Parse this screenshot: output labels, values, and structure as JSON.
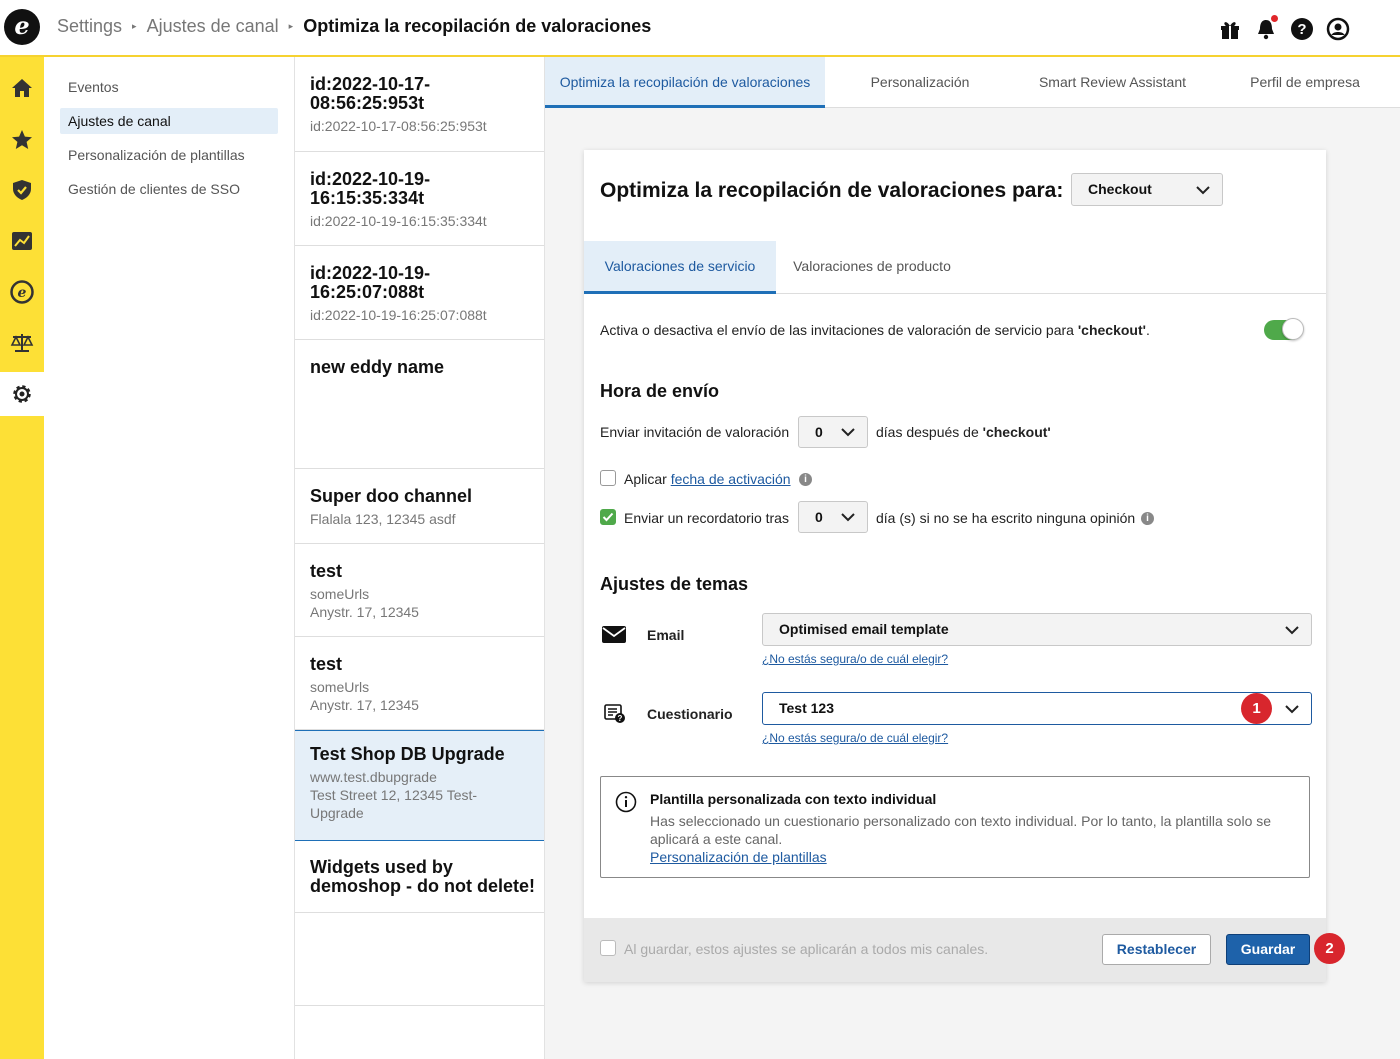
{
  "app": {
    "logo_glyph": "e",
    "accent": "#fde036",
    "brand_blue": "#1e6fb7"
  },
  "breadcrumb": {
    "items": [
      "Settings",
      "Ajustes de canal"
    ],
    "current": "Optimiza la recopilación de valoraciones"
  },
  "top_icons": [
    "gift-icon",
    "bell-icon",
    "help-icon",
    "user-icon"
  ],
  "rail": {
    "items": [
      "home-icon",
      "star-icon",
      "shield-icon",
      "chart-icon",
      "e-logo-icon",
      "scales-icon",
      "gear-icon"
    ],
    "active": "gear-icon"
  },
  "subnav": {
    "items": [
      {
        "label": "Eventos"
      },
      {
        "label": "Ajustes de canal",
        "active": true
      },
      {
        "label": "Personalización de plantillas"
      },
      {
        "label": "Gestión de clientes de SSO"
      }
    ]
  },
  "channels": [
    {
      "title": "id:2022-10-17-08:56:25:953t",
      "sub": [
        "id:2022-10-17-08:56:25:953t"
      ]
    },
    {
      "title": "id:2022-10-19-16:15:35:334t",
      "sub": [
        "id:2022-10-19-16:15:35:334t"
      ]
    },
    {
      "title": "id:2022-10-19-16:25:07:088t",
      "sub": [
        "id:2022-10-19-16:25:07:088t"
      ]
    },
    {
      "title": "new eddy name",
      "sub": []
    },
    {
      "title": "Super doo channel",
      "sub": [
        "Flalala 123, 12345 asdf"
      ]
    },
    {
      "title": "test",
      "sub": [
        "someUrls",
        "Anystr. 17, 12345"
      ]
    },
    {
      "title": "test",
      "sub": [
        "someUrls",
        "Anystr. 17, 12345"
      ]
    },
    {
      "title": "Test Shop DB Upgrade",
      "sub": [
        "www.test.dbupgrade",
        "Test Street 12, 12345 Test-Upgrade"
      ],
      "selected": true
    },
    {
      "title": "Widgets used by demoshop - do not delete!",
      "sub": []
    }
  ],
  "main_tabs": [
    {
      "label": "Optimiza la recopilación de valoraciones",
      "active": true
    },
    {
      "label": "Personalización"
    },
    {
      "label": "Smart Review Assistant"
    },
    {
      "label": "Perfil de empresa"
    }
  ],
  "card": {
    "title": "Optimiza la recopilación de valoraciones para:",
    "channel_select": "Checkout",
    "review_tabs": [
      {
        "label": "Valoraciones de servicio",
        "active": true
      },
      {
        "label": "Valoraciones de producto"
      }
    ],
    "toggle_text_pre": "Activa o desactiva el envío de las invitaciones de valoración de servicio para ",
    "toggle_text_bold": "'checkout'",
    "toggle_text_post": ".",
    "toggle_on": true,
    "send_time": {
      "heading": "Hora de envío",
      "send_label": "Enviar invitación de valoración",
      "days_value": "0",
      "after_pre": "días después de ",
      "after_bold": "'checkout'",
      "apply_pre": "Aplicar ",
      "apply_link": "fecha de activación",
      "apply_checked": false,
      "reminder_label": "Enviar un recordatorio tras",
      "reminder_checked": true,
      "reminder_value": "0",
      "reminder_suffix": "día (s) si no se ha escrito ninguna opinión"
    },
    "themes": {
      "heading": "Ajustes de temas",
      "email_label": "Email",
      "email_value": "Optimised email template",
      "help_link": "¿No estás segura/o de cuál elegir?",
      "questionnaire_label": "Cuestionario",
      "questionnaire_value": "Test 123",
      "badge1": "1"
    },
    "notice": {
      "title": "Plantilla personalizada con texto individual",
      "body": "Has seleccionado un cuestionario personalizado con texto individual. Por lo tanto, la plantilla solo se aplicará a este canal.",
      "link": "Personalización de plantillas"
    },
    "footer": {
      "apply_all": "Al guardar, estos ajustes se aplicarán a todos mis canales.",
      "reset": "Restablecer",
      "save": "Guardar",
      "badge2": "2"
    }
  }
}
